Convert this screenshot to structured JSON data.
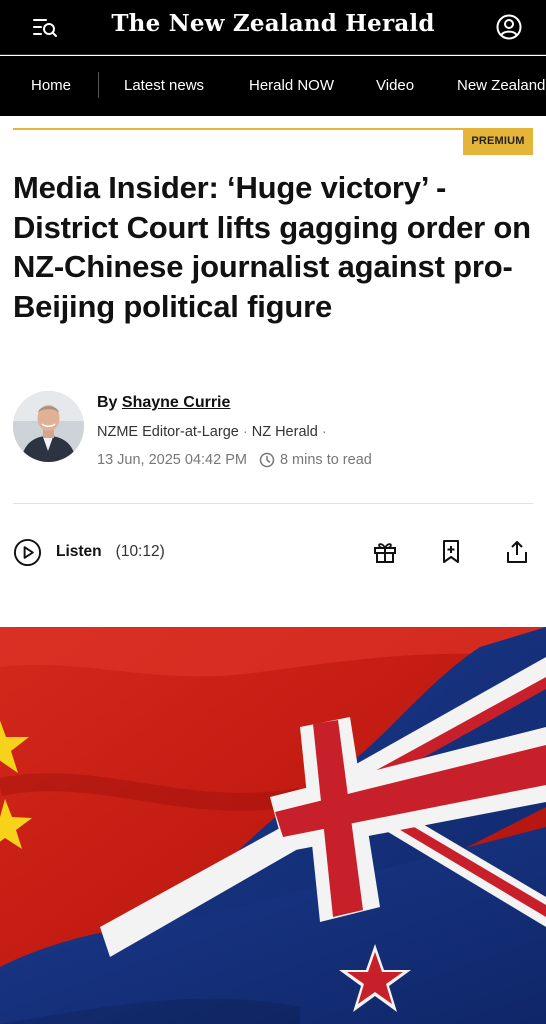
{
  "header": {
    "masthead": "The New Zealand Herald",
    "menu_icon": "menu-search-icon",
    "account_icon": "account-icon"
  },
  "nav": {
    "items": [
      {
        "label": "Home"
      },
      {
        "label": "Latest news"
      },
      {
        "label": "Herald NOW"
      },
      {
        "label": "Video"
      },
      {
        "label": "New Zealand"
      }
    ]
  },
  "article": {
    "badge": "PREMIUM",
    "headline": "Media Insider: ‘Huge victory’ - District Court lifts gagging order on NZ-Chinese journalist against pro-Beijing political figure",
    "byline_prefix": "By",
    "author": "Shayne Currie",
    "role": "NZME Editor-at-Large",
    "publication": "NZ Herald",
    "date": "13 Jun, 2025 04:42 PM",
    "read_time": "8 mins to read"
  },
  "audio": {
    "label": "Listen",
    "duration": "(10:12)"
  },
  "actions": {
    "gift_icon": "gift-icon",
    "bookmark_icon": "bookmark-add-icon",
    "share_icon": "share-icon"
  },
  "hero": {
    "subject": "China and New Zealand flags"
  },
  "colors": {
    "header_bg": "#000000",
    "premium_gold": "#e5b53a",
    "text": "#111111",
    "muted": "#777777"
  }
}
